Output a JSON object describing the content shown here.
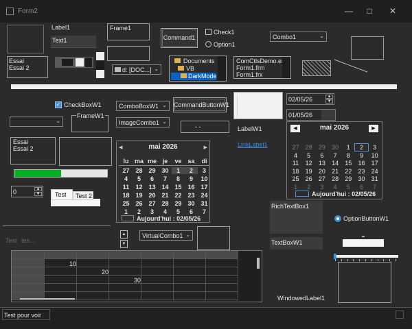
{
  "window": {
    "title": "Form2"
  },
  "labels": {
    "label1": "Label1",
    "frame1": "Frame1",
    "frame_w1": "FrameW1",
    "label_w1": "LabelW1",
    "link_label1": "LinkLabel1",
    "rich_textbox1": "RichTextBox1",
    "textbox_w1": "TextBoxW1",
    "windowed_label1": "WindowedLabel1"
  },
  "text1": {
    "value": "Text1"
  },
  "list1": {
    "items": [
      "Essai",
      "Essai 2"
    ]
  },
  "list2": {
    "items": [
      "Essai",
      "Essai 2"
    ]
  },
  "buttons": {
    "command1": "Command1",
    "command_button_w1": "CommandButtonW1"
  },
  "checks": {
    "check1": "Check1",
    "checkbox_w1": "CheckBoxW1"
  },
  "options": {
    "option1": "Option1",
    "option_button_w1": "OptionButtonW1"
  },
  "combos": {
    "combo1": "Combo1",
    "combobox_w1": "ComboBoxW1",
    "image_combo1": "ImageCombo1",
    "virtual_combo1": "VirtualCombo1"
  },
  "drive1": {
    "value": "d: [DOC...]"
  },
  "dir1": {
    "items": [
      "Documents",
      "VB",
      "DarkMode"
    ],
    "selected": 2
  },
  "file1": {
    "items": [
      "ComCtlsDemo.exe",
      "Form1.frm",
      "Form1.frx"
    ]
  },
  "dtpicker1": {
    "value": "02/05/26"
  },
  "dtpicker2": {
    "value": "01/05/26"
  },
  "masked_edit": {
    "value": "-    -"
  },
  "updown": {
    "value": "0"
  },
  "progress": {
    "value": 0.5
  },
  "tabs": {
    "items": [
      "Test",
      "Test 2"
    ]
  },
  "tabstrip_faded": {
    "items": [
      "Test",
      "tes..."
    ]
  },
  "calendar_left": {
    "month": "mai 2026",
    "weekdays": [
      "lu",
      "ma",
      "me",
      "je",
      "ve",
      "sa",
      "di"
    ],
    "weeks": [
      [
        "27",
        "28",
        "29",
        "30",
        "1",
        "2",
        "3"
      ],
      [
        "4",
        "5",
        "6",
        "7",
        "8",
        "9",
        "10"
      ],
      [
        "11",
        "12",
        "13",
        "14",
        "15",
        "16",
        "17"
      ],
      [
        "18",
        "19",
        "20",
        "21",
        "22",
        "23",
        "24"
      ],
      [
        "25",
        "26",
        "27",
        "28",
        "29",
        "30",
        "31"
      ],
      [
        "1",
        "2",
        "3",
        "4",
        "5",
        "6",
        "7"
      ]
    ],
    "today_label": "Aujourd'hui : 02/05/26"
  },
  "calendar_right": {
    "month": "mai 2026",
    "weeks": [
      [
        "27",
        "28",
        "29",
        "30",
        "1",
        "2",
        "3"
      ],
      [
        "4",
        "5",
        "6",
        "7",
        "8",
        "9",
        "10"
      ],
      [
        "11",
        "12",
        "13",
        "14",
        "15",
        "16",
        "17"
      ],
      [
        "18",
        "19",
        "20",
        "21",
        "22",
        "23",
        "24"
      ],
      [
        "25",
        "26",
        "27",
        "28",
        "29",
        "30",
        "31"
      ],
      [
        "1",
        "2",
        "3",
        "4",
        "5",
        "6",
        "7"
      ]
    ],
    "today_label": "Aujourd'hui : 02/05/26"
  },
  "flexgrid": {
    "values": [
      "10",
      "20",
      "30"
    ]
  },
  "slider": {
    "value": 0.0
  },
  "statusbar": {
    "text": "Test pour voir"
  }
}
